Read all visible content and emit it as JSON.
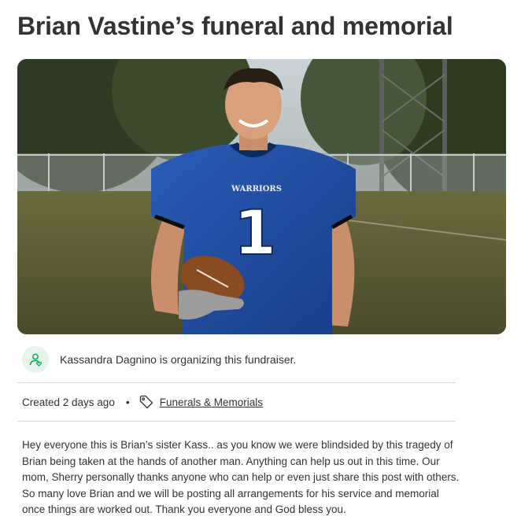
{
  "campaign": {
    "title": "Brian Vastine’s funeral and memorial",
    "hero_image_alt": "Photo of Brian in a blue Warriors football jersey number 1 holding a football",
    "jersey_text": "WARRIORS",
    "jersey_number": "1"
  },
  "organizer": {
    "icon": "person-heart-icon",
    "text": "Kassandra Dagnino is organizing this fundraiser."
  },
  "meta": {
    "created": "Created 2 days ago",
    "separator": "•",
    "category_icon": "tag-icon",
    "category": "Funerals & Memorials"
  },
  "story": {
    "text": "Hey everyone this is Brian’s sister Kass.. as you know we were blindsided by this tragedy of Brian being taken at the hands of another man. Anything can help us out in this time. Our mom, Sherry personally thanks anyone who can help or even just share this post with others. So many love Brian and we will be posting all arrangements for his service and memorial once things are worked out. Thank you everyone and God bless you."
  },
  "colors": {
    "text": "#333333",
    "divider": "#d8d8d8",
    "avatar_bg": "#e6f4ea",
    "avatar_icon": "#02a95c",
    "jersey_blue": "#1f4fa8"
  }
}
